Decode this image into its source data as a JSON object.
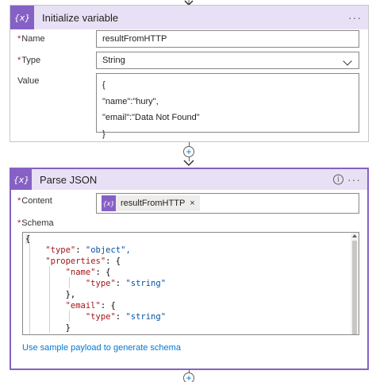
{
  "initialize_variable": {
    "icon": "variable-icon",
    "icon_glyph": "{x}",
    "title": "Initialize variable",
    "menu": "···",
    "fields": {
      "name_label": "Name",
      "name_value": "resultFromHTTP",
      "type_label": "Type",
      "type_value": "String",
      "value_label": "Value",
      "value_lines": [
        "{",
        "\"name\":\"hury\",",
        "\"email\":\"Data Not Found\"",
        "}"
      ]
    }
  },
  "parse_json": {
    "icon": "variable-icon",
    "icon_glyph": "{x}",
    "title": "Parse JSON",
    "info_glyph": "i",
    "menu": "···",
    "content_label": "Content",
    "content_token": {
      "icon_glyph": "{x}",
      "text": "resultFromHTTP",
      "remove": "×"
    },
    "schema_label": "Schema",
    "schema_lines": [
      [
        "{",
        "",
        "",
        ""
      ],
      [
        "    ",
        "\"type\"",
        ": ",
        "\"object\","
      ],
      [
        "    ",
        "\"properties\"",
        ": {",
        ""
      ],
      [
        "        ",
        "\"name\"",
        ": {",
        ""
      ],
      [
        "            ",
        "\"type\"",
        ": ",
        "\"string\""
      ],
      [
        "        ",
        "",
        "},",
        ""
      ],
      [
        "        ",
        "\"email\"",
        ": {",
        ""
      ],
      [
        "            ",
        "\"type\"",
        ": ",
        "\"string\""
      ],
      [
        "        ",
        "",
        "}",
        ""
      ],
      [
        "    ",
        "",
        "}",
        ""
      ]
    ],
    "sample_payload_link": "Use sample payload to generate schema"
  },
  "connector": {
    "plus_glyph": "+"
  },
  "colors": {
    "accent": "#8661c5",
    "header_bg": "#e8e1f5",
    "link": "#0078d4",
    "required": "#a4262c"
  }
}
